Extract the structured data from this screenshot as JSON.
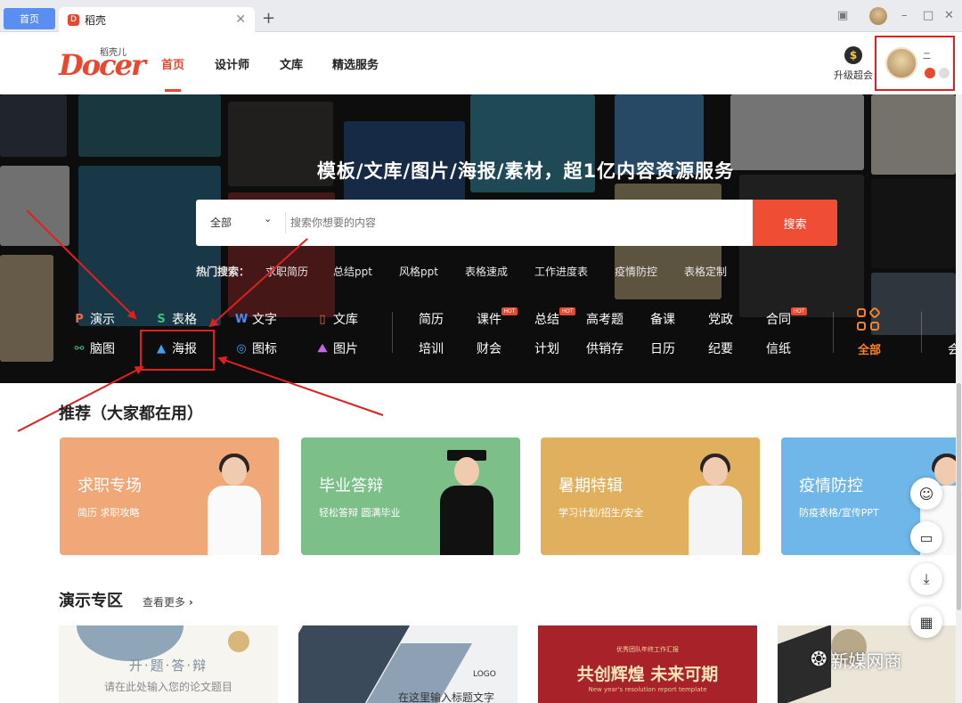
{
  "browser": {
    "home_tab": "首页",
    "active_tab": "稻壳",
    "tab_logo": "D",
    "close_glyph": "✕",
    "add_glyph": "+"
  },
  "header": {
    "logo_text": "Docer",
    "logo_sub": "稻壳儿",
    "nav": [
      "首页",
      "设计师",
      "文库",
      "精选服务"
    ],
    "vip_label": "升级超会",
    "vip_coin": "$",
    "user_name": "二"
  },
  "banner": {
    "slogan": "模板/文库/图片/海报/素材，超1亿内容资源服务",
    "search": {
      "category": "全部",
      "placeholder": "搜索你想要的内容",
      "button": "搜索"
    },
    "hot_label": "热门搜索：",
    "hot_items": [
      "求职简历",
      "总结ppt",
      "风格ppt",
      "表格速成",
      "工作进度表",
      "疫情防控",
      "表格定制"
    ],
    "tools_row1": [
      {
        "label": "演示",
        "icon": "P",
        "color": "#f06a4a"
      },
      {
        "label": "表格",
        "icon": "S",
        "color": "#39c07a"
      },
      {
        "label": "文字",
        "icon": "W",
        "color": "#4a8cf0"
      },
      {
        "label": "文库",
        "icon": "▯",
        "color": "#f06a4a"
      }
    ],
    "tools_row2": [
      {
        "label": "脑图",
        "icon": "⚯",
        "color": "#39c07a"
      },
      {
        "label": "海报",
        "icon": "▲",
        "color": "#3fa0f0"
      },
      {
        "label": "图标",
        "icon": "◎",
        "color": "#3fa0f0"
      },
      {
        "label": "图片",
        "icon": "⛰",
        "color": "#c466e6"
      }
    ],
    "topics_row1": [
      "简历",
      "课件",
      "总结",
      "高考题",
      "备课",
      "党政",
      "合同"
    ],
    "topics_row2": [
      "培训",
      "财会",
      "计划",
      "供销存",
      "日历",
      "纪要",
      "信纸"
    ],
    "hot_badge": "HOT",
    "all_label": "全部",
    "edge_label": "会"
  },
  "recommend": {
    "title": "推荐（大家都在用）",
    "cards": [
      {
        "title": "求职专场",
        "sub": "简历  求职攻略",
        "color": "#f0a878"
      },
      {
        "title": "毕业答辩",
        "sub": "轻松答辩  圆满毕业",
        "color": "#7cbf88"
      },
      {
        "title": "暑期特辑",
        "sub": "学习计划/招生/安全",
        "color": "#e0b05e"
      },
      {
        "title": "疫情防控",
        "sub": "防疫表格/宣传PPT",
        "color": "#6fb7e8"
      }
    ]
  },
  "present": {
    "title": "演示专区",
    "more": "查看更多",
    "more_chev": "›",
    "tpl1_title": "开·题·答·辩",
    "tpl1_sub": "请在此处输入您的论文题目",
    "tpl2_logo": "LOGO",
    "tpl2_text": "在这里输入标题文字",
    "tpl3_title": "共创辉煌  未来可期",
    "tpl3_sub": "New year's resolution report template",
    "tpl3_top": "优秀团队年终工作汇报"
  },
  "floating": [
    "user-icon",
    "chat-icon",
    "download-icon",
    "qrcode-icon"
  ],
  "watermark": "新媒网商"
}
